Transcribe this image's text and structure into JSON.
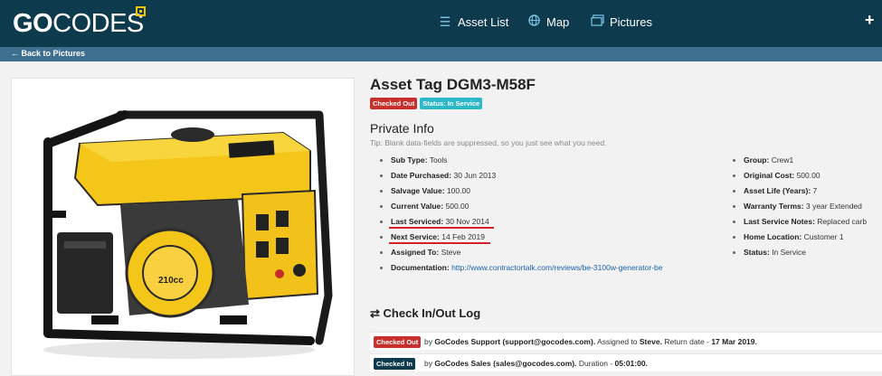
{
  "brand": {
    "name_bold": "GO",
    "name_rest": "CODES"
  },
  "nav": {
    "asset_list": "Asset List",
    "map": "Map",
    "pictures": "Pictures",
    "plus": "+"
  },
  "back_label": "Back to Pictures",
  "asset": {
    "title": "Asset Tag DGM3-M58F",
    "badge_checked_out": "Checked Out",
    "badge_status": "Status: In Service"
  },
  "private_info": {
    "heading": "Private Info",
    "tip": "Tip: Blank data-fields are suppressed, so you just see what you need.",
    "left_fields": [
      {
        "label": "Sub Type:",
        "value": "Tools"
      },
      {
        "label": "Date Purchased:",
        "value": "30 Jun 2013"
      },
      {
        "label": "Salvage Value:",
        "value": "100.00"
      },
      {
        "label": "Current Value:",
        "value": "500.00"
      },
      {
        "label": "Last Serviced:",
        "value": "30 Nov 2014"
      },
      {
        "label": "Next Service:",
        "value": "14 Feb 2019"
      },
      {
        "label": "Assigned To:",
        "value": "Steve"
      },
      {
        "label": "Documentation:",
        "value": "http://www.contractortalk.com/reviews/be-3100w-generator-be"
      }
    ],
    "right_fields": [
      {
        "label": "Group:",
        "value": "Crew1"
      },
      {
        "label": "Original Cost:",
        "value": "500.00"
      },
      {
        "label": "Asset Life (Years):",
        "value": "7"
      },
      {
        "label": "Warranty Terms:",
        "value": "3 year Extended"
      },
      {
        "label": "Last Service Notes:",
        "value": "Replaced carb"
      },
      {
        "label": "Home Location:",
        "value": "Customer 1"
      },
      {
        "label": "Status:",
        "value": "In Service"
      }
    ]
  },
  "log": {
    "heading": "Check In/Out Log",
    "entries": [
      {
        "badge": "Checked Out",
        "by": "by",
        "who": "GoCodes Support (support@gocodes.com).",
        "extra_label": "Assigned to",
        "extra_value": "Steve.",
        "date_label": "Return date -",
        "date_value": "17 Mar 2019."
      },
      {
        "badge": "Checked In",
        "by": "by",
        "who": "GoCodes Sales (sales@gocodes.com).",
        "date_label": "Duration -",
        "date_value": "05:01:00."
      }
    ]
  },
  "colors": {
    "topbar": "#0e3a4e",
    "subbar": "#3f6f8e",
    "accent_yellow": "#f2c500",
    "badge_red": "#c9302c",
    "badge_teal": "#2bb8c9",
    "underline_red": "#d6202a",
    "link_blue": "#1a62a8"
  },
  "icons": {
    "asset_list": "list-icon",
    "map": "globe-icon",
    "pictures": "pictures-icon",
    "back": "arrow-left-icon",
    "log": "swap-arrows-icon"
  }
}
